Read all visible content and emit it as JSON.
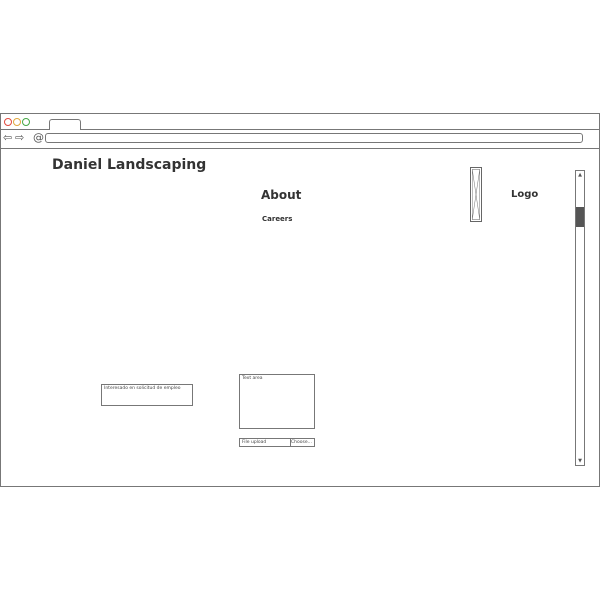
{
  "browser": {
    "address": ""
  },
  "header": {
    "site_title": "Daniel Landscaping",
    "logo_label": "Logo"
  },
  "nav": {
    "about_label": "About",
    "careers_label": "Careers"
  },
  "form": {
    "text_input_value": "Interesado en solicitud de empleo",
    "text_area_value": "Text area",
    "file_field_placeholder": "File upload",
    "file_button_label": "Choose..."
  },
  "icons": {
    "back": "arrow-left-icon",
    "forward": "arrow-right-icon",
    "reload": "reload-icon",
    "scroll_up": "triangle-up-icon",
    "scroll_down": "triangle-down-icon"
  },
  "scroll": {
    "position_fraction": 0.11
  }
}
